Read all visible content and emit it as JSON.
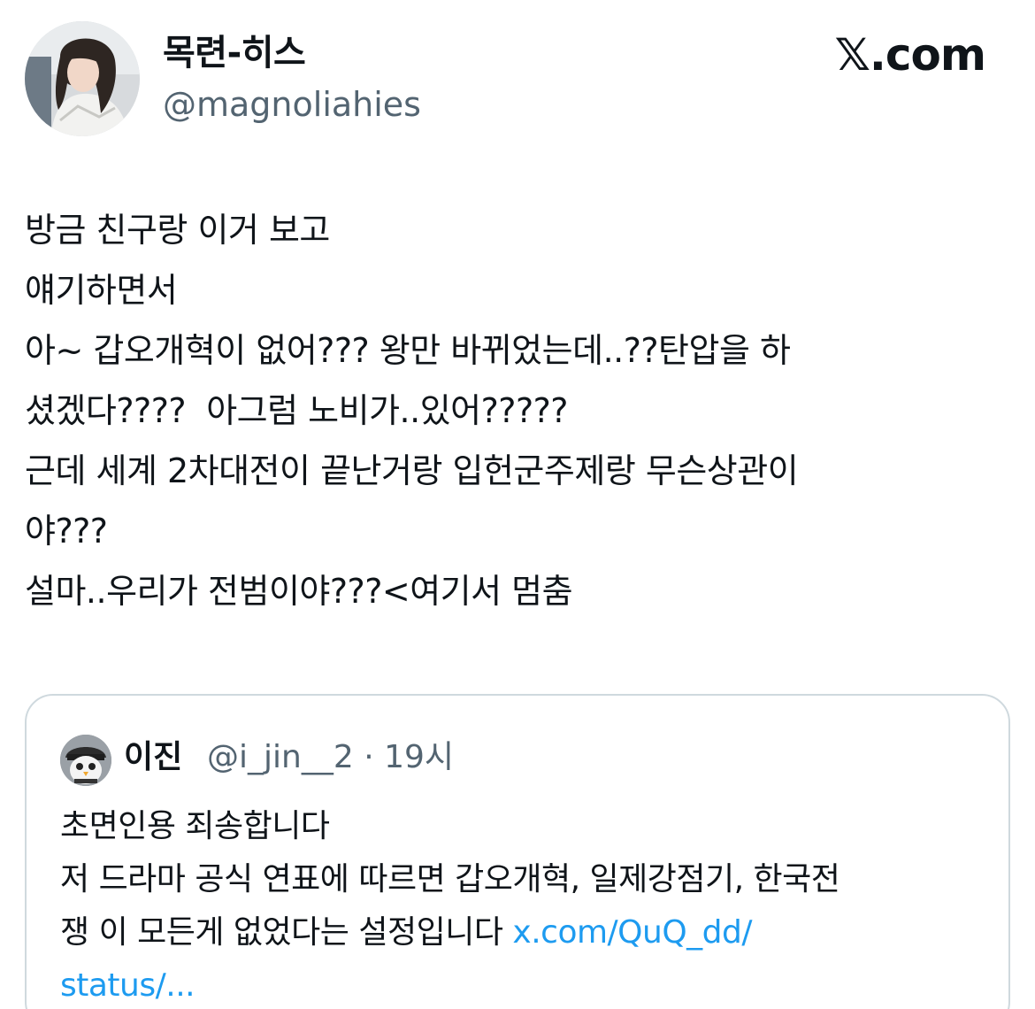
{
  "author": {
    "display_name": "목련-히스",
    "handle": "@magnoliahies"
  },
  "brand": "𝕏.com",
  "tweet": {
    "lines": [
      "방금 친구랑 이거 보고",
      "얘기하면서",
      "아~ 갑오개혁이 없어??? 왕만 바뀌었는데..??탄압을 하",
      "셨겠다????  아그럼 노비가..있어?????",
      "근데 세계 2차대전이 끝난거랑 입헌군주제랑 무슨상관이",
      "야???",
      "설마..우리가 전범이야???<여기서 멈춤"
    ]
  },
  "quoted": {
    "display_name": "이진",
    "handle": "@i_jin__2",
    "separator": "·",
    "time": "19시",
    "lines": [
      "초면인용 죄송합니다",
      "저 드라마 공식 연표에 따르면 갑오개혁, 일제강점기, 한국전",
      "쟁 이 모든게 없었다는 설정입니다 "
    ],
    "link_part1": "x.com/QuQ_dd/",
    "link_part2": "status/..."
  },
  "colors": {
    "text": "#0f1419",
    "secondary": "#536471",
    "link": "#1d9bf0",
    "border": "#cfd9de"
  }
}
